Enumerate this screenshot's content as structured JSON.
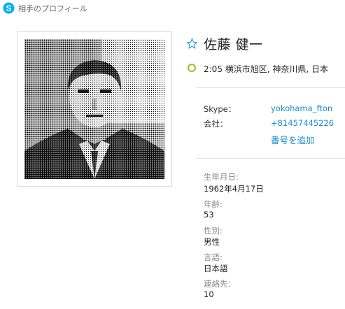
{
  "window": {
    "title": "相手のプロフィール",
    "logo": "skype-logo"
  },
  "profile": {
    "name": "佐藤 健一",
    "favorite_icon": "star-outline-icon",
    "status_icon": "status-away-ring-icon",
    "location": "2:05 横浜市旭区, 神奈川県, 日本"
  },
  "contacts": {
    "skype_label": "Skype：",
    "skype_value": "yokohama_fton",
    "company_label": "会社：",
    "company_value": "+81457445226",
    "add_number": "番号を追加"
  },
  "details": [
    {
      "label": "生年月日:",
      "value": "1962年4月17日"
    },
    {
      "label": "年齢:",
      "value": "53"
    },
    {
      "label": "性別:",
      "value": "男性"
    },
    {
      "label": "言語:",
      "value": "日本語"
    },
    {
      "label": "連絡先：",
      "value": "10"
    }
  ],
  "colors": {
    "link": "#1a8ccd",
    "skype_blue": "#00aff0",
    "status_ring": "#9bbd2c"
  }
}
